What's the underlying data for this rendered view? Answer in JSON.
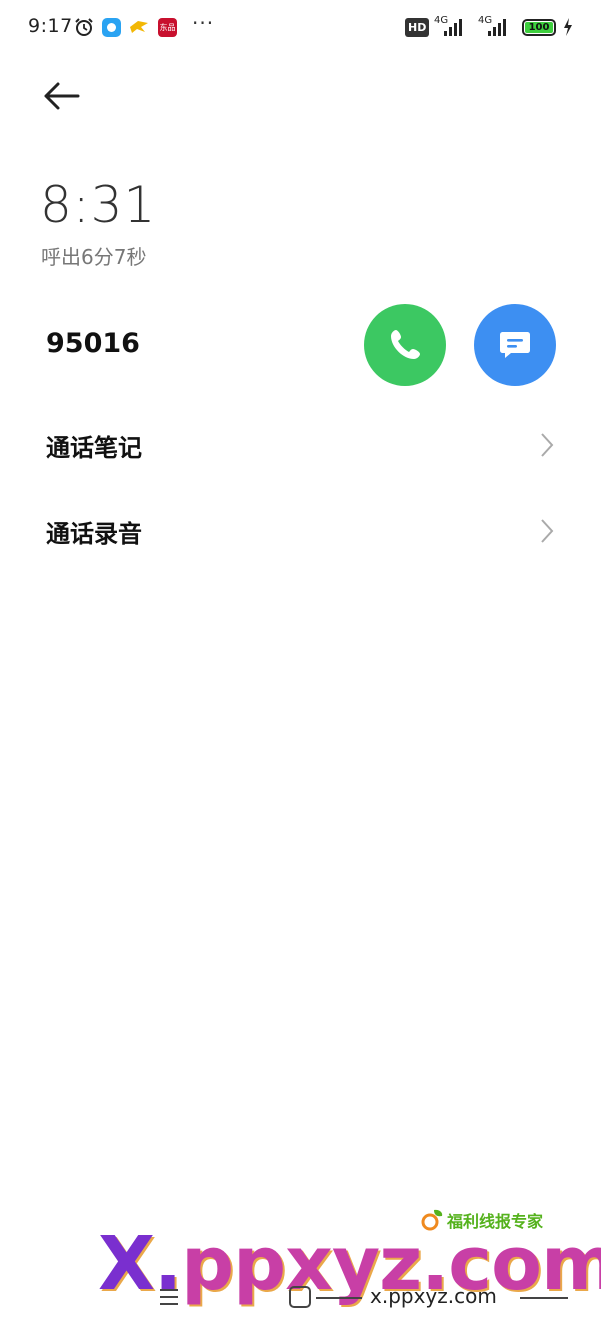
{
  "status_bar": {
    "time": "9:17",
    "app3_label": "东品",
    "more": "···",
    "hd_label": "HD",
    "sim1_net": "4G",
    "sim2_net": "4G",
    "battery": "100",
    "battery_color": "#3ecf3e"
  },
  "call": {
    "time": "8:31",
    "description": "呼出6分7秒",
    "number": "95016",
    "call_color": "#3cc862",
    "message_color": "#3d8ff2"
  },
  "menu": [
    {
      "label": "通话笔记"
    },
    {
      "label": "通话录音"
    }
  ],
  "watermark": {
    "brand": "福利线报专家",
    "site_big_prefix": "X.",
    "site_big_rest": "ppxyz.com",
    "site_small": "x.ppxyz.com"
  }
}
